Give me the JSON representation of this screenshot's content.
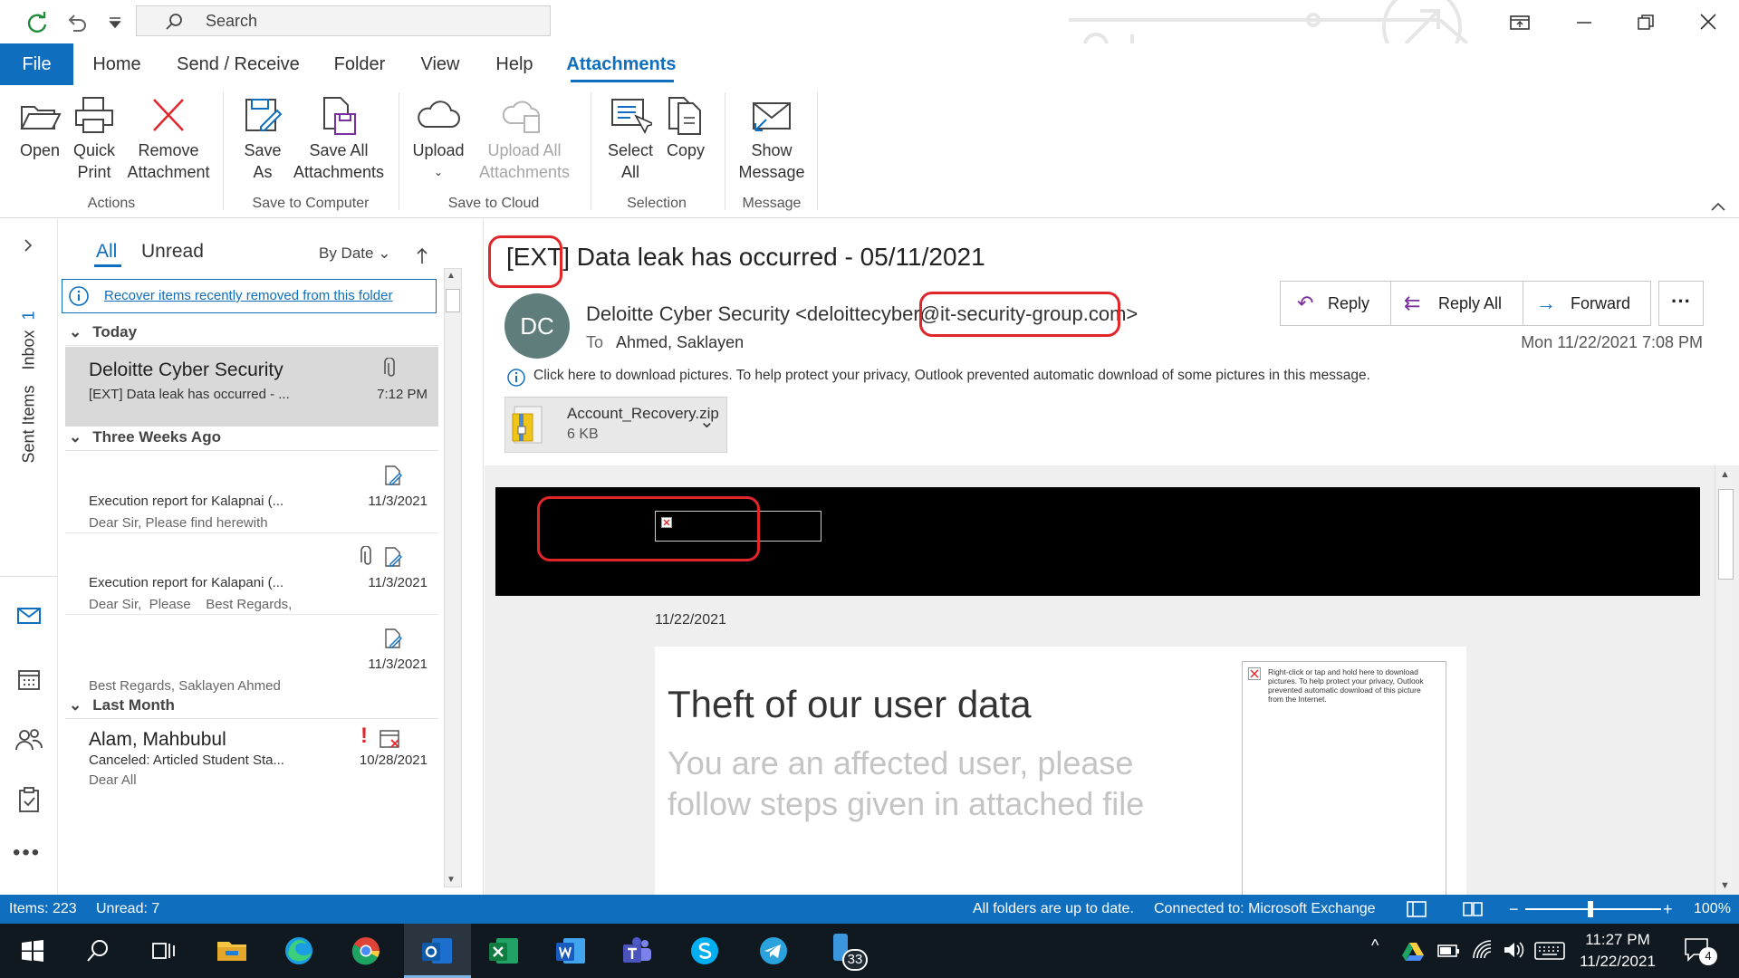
{
  "titlebar": {
    "search_placeholder": "Search"
  },
  "tabs": [
    "File",
    "Home",
    "Send / Receive",
    "Folder",
    "View",
    "Help",
    "Attachments"
  ],
  "ribbon": {
    "open": "Open",
    "quick_print": [
      "Quick",
      "Print"
    ],
    "remove_attachment": [
      "Remove",
      "Attachment"
    ],
    "save_as": [
      "Save",
      "As"
    ],
    "save_all": [
      "Save All",
      "Attachments"
    ],
    "upload": "Upload",
    "upload_all": [
      "Upload All",
      "Attachments"
    ],
    "select_all": [
      "Select",
      "All"
    ],
    "copy": "Copy",
    "show_message": [
      "Show",
      "Message"
    ],
    "groups": {
      "actions": "Actions",
      "save_to_computer": "Save to Computer",
      "save_to_cloud": "Save to Cloud",
      "selection": "Selection",
      "message": "Message"
    }
  },
  "nav": {
    "inbox": "Inbox",
    "inbox_count": "1",
    "sent": "Sent Items"
  },
  "list": {
    "filter_all": "All",
    "filter_unread": "Unread",
    "sort": "By Date",
    "recover": "Recover items recently removed from this folder",
    "groups": [
      "Today",
      "Three Weeks Ago",
      "Last Month"
    ],
    "items": [
      {
        "sender": "Deloitte Cyber Security",
        "subject": "[EXT] Data leak has occurred - ...",
        "time": "7:12 PM"
      },
      {
        "subject": "Execution report for Kalapnai (...",
        "preview": "Dear Sir,  Please find herewith",
        "time": "11/3/2021"
      },
      {
        "subject": "Execution report for Kalapani (...",
        "preview": "Dear Sir,  Please    Best Regards,",
        "time": "11/3/2021"
      },
      {
        "preview": "Best Regards,  Saklayen Ahmed",
        "time": "11/3/2021"
      },
      {
        "sender": "Alam, Mahbubul",
        "subject": "Canceled: Articled Student Sta...",
        "time": "10/28/2021",
        "preview": "Dear All"
      }
    ]
  },
  "message": {
    "tag": "[EXT]",
    "subject": "Data leak has occurred - 05/11/2021",
    "initials": "DC",
    "from_name": "Deloitte Cyber Security <deloittecyber",
    "from_domain": "@it-security-group.com>",
    "to_label": "To",
    "to": "Ahmed, Saklayen",
    "date": "Mon 11/22/2021 7:08 PM",
    "reply": "Reply",
    "reply_all": "Reply All",
    "forward": "Forward",
    "info": "Click here to download pictures. To help protect your privacy, Outlook prevented automatic download of some pictures in this message.",
    "attachment_name": "Account_Recovery.zip",
    "attachment_size": "6 KB",
    "body_date": "11/22/2021",
    "headline": "Theft of our user data",
    "subline": "You are an affected user, please follow steps given in attached file",
    "blocked_img": "Right-click or tap and hold here to download pictures. To help protect your privacy, Outlook prevented automatic download of this picture from the Internet."
  },
  "status": {
    "items": "Items: 223",
    "unread": "Unread: 7",
    "sync": "All folders are up to date.",
    "connected": "Connected to: Microsoft Exchange",
    "zoom": "100%"
  },
  "taskbar": {
    "time": "11:27 PM",
    "date": "11/22/2021",
    "phone_badge": "33",
    "notif_badge": "4"
  },
  "colors": {
    "accent": "#106ebe",
    "alert": "#e0262b",
    "taskbar": "#101820"
  }
}
